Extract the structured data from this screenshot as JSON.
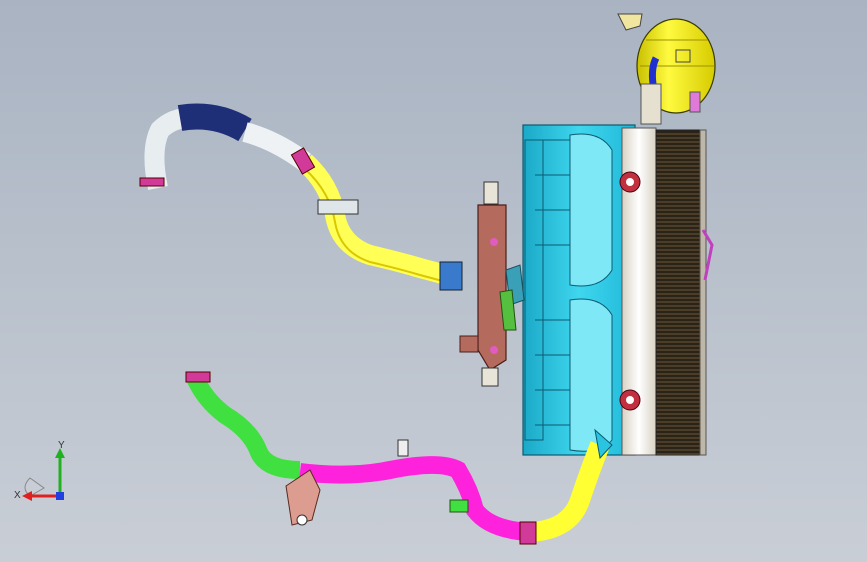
{
  "viewport": {
    "background_top": "#a9b3c2",
    "background_bottom": "#c9ced6"
  },
  "model": {
    "parts": [
      {
        "id": "upper-hose",
        "color": "#ffff55",
        "shade": "#d9c800"
      },
      {
        "id": "upper-hose-coupler",
        "color": "#1e2f78"
      },
      {
        "id": "upper-hose-end",
        "color": "#e8eef0"
      },
      {
        "id": "lower-hose",
        "color": "#ff22dd"
      },
      {
        "id": "lower-hose-end",
        "color": "#3fe03f"
      },
      {
        "id": "outlet-hose",
        "color": "#ffff33"
      },
      {
        "id": "fan-shroud",
        "color": "#29c4e0"
      },
      {
        "id": "radiator-core",
        "color": "#2b2218"
      },
      {
        "id": "radiator-tank",
        "color": "#f1eee6"
      },
      {
        "id": "coolant-reservoir",
        "color": "#f2ea2a"
      },
      {
        "id": "mounting-bracket",
        "color": "#b56a5e"
      },
      {
        "id": "clamp",
        "color": "#d23a9a"
      }
    ]
  },
  "triad": {
    "x_label": "X",
    "y_label": "Y",
    "x_color": "#e02020",
    "y_color": "#20b020",
    "z_color": "#2040e0"
  }
}
